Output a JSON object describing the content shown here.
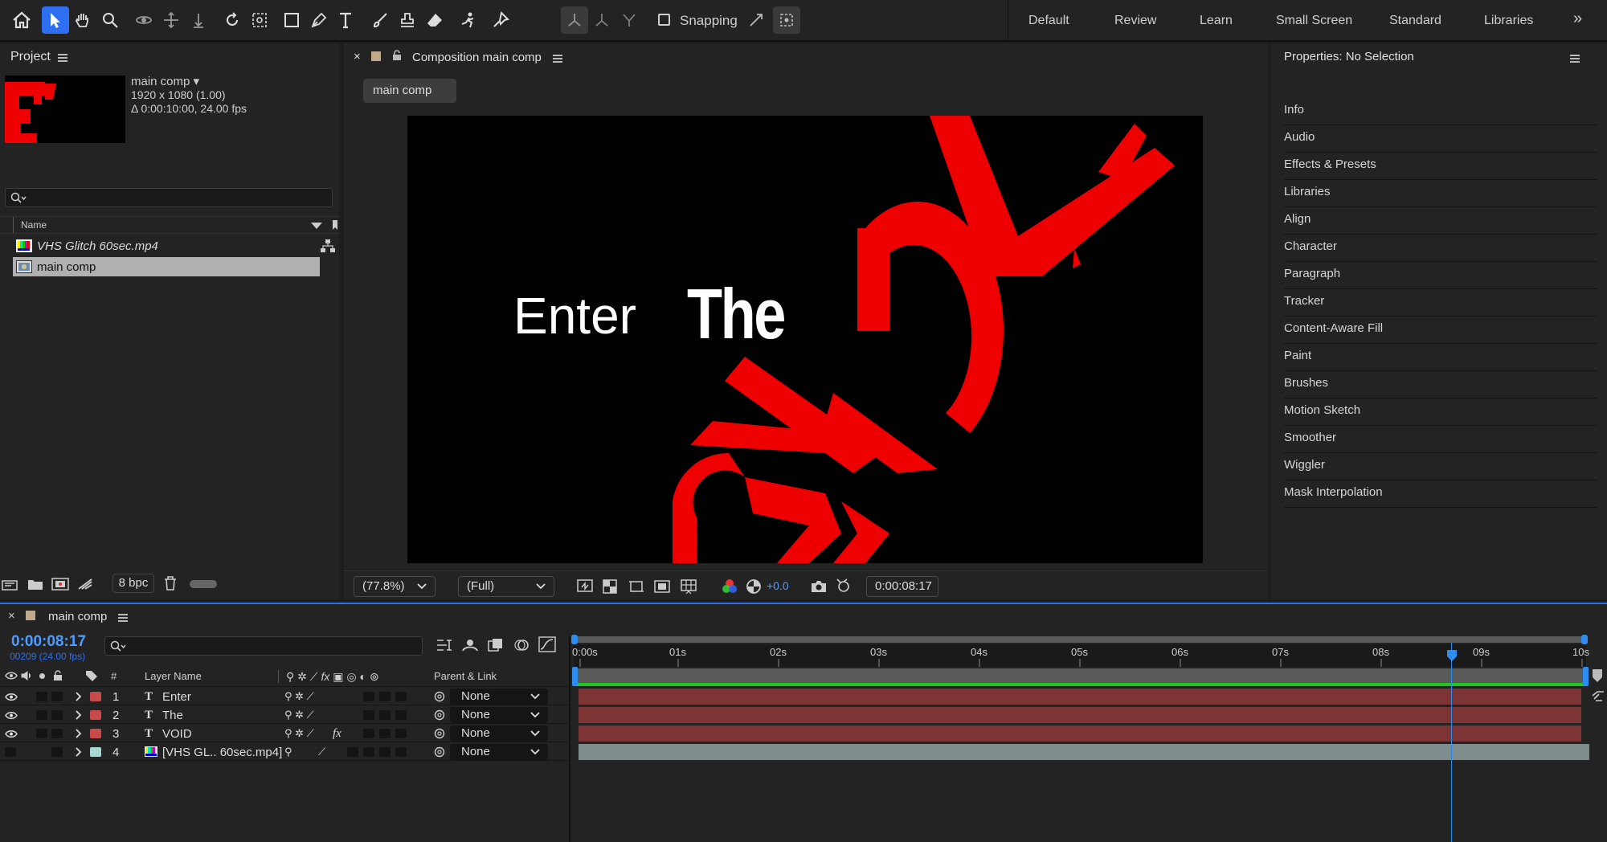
{
  "toolbar": {
    "snapping_label": "Snapping",
    "workspaces": [
      "Default",
      "Review",
      "Learn",
      "Small Screen",
      "Standard",
      "Libraries"
    ],
    "overflow": "»"
  },
  "project": {
    "title": "Project",
    "comp_name": "main comp ▾",
    "comp_size": "1920 x 1080 (1.00)",
    "comp_duration": "Δ 0:00:10:00, 24.00 fps",
    "search_placeholder": "",
    "column_name": "Name",
    "items": [
      {
        "name": "VHS Glitch 60sec.mp4",
        "type": "footage"
      },
      {
        "name": "main comp",
        "type": "composition"
      }
    ],
    "bpc": "8 bpc"
  },
  "viewer": {
    "close": "×",
    "title": "Composition main comp",
    "tab": "main comp",
    "canvas_text_enter": "Enter",
    "canvas_text_the": "The",
    "zoom": "(77.8%)",
    "resolution": "(Full)",
    "exposure": "+0.0",
    "timecode": "0:00:08:17"
  },
  "properties": {
    "title": "Properties: No Selection",
    "items": [
      "Info",
      "Audio",
      "Effects & Presets",
      "Libraries",
      "Align",
      "Character",
      "Paragraph",
      "Tracker",
      "Content-Aware Fill",
      "Paint",
      "Brushes",
      "Motion Sketch",
      "Smoother",
      "Wiggler",
      "Mask Interpolation"
    ]
  },
  "timeline": {
    "close": "×",
    "tab": "main comp",
    "timecode": "0:00:08:17",
    "frame_info": "00209 (24.00 fps)",
    "col_num": "#",
    "col_layer_name": "Layer Name",
    "col_parent": "Parent & Link",
    "ruler": [
      "0:00s",
      "01s",
      "02s",
      "03s",
      "04s",
      "05s",
      "06s",
      "07s",
      "08s",
      "09s",
      "10s"
    ],
    "layers": [
      {
        "num": "1",
        "type_icon": "T",
        "name": "Enter",
        "label_color": "#c84a4a",
        "parent": "None",
        "fx": ""
      },
      {
        "num": "2",
        "type_icon": "T",
        "name": "The",
        "label_color": "#c84a4a",
        "parent": "None",
        "fx": ""
      },
      {
        "num": "3",
        "type_icon": "T",
        "name": "VOID",
        "label_color": "#c84a4a",
        "parent": "None",
        "fx": "fx"
      },
      {
        "num": "4",
        "type_icon": "",
        "name": "[VHS GL.. 60sec.mp4]",
        "label_color": "#a7d6d3",
        "parent": "None",
        "fx": ""
      }
    ],
    "colors": {
      "text_bar": "#7d3434",
      "video_bar": "#7f8c8d",
      "work_area": "#1ec81e",
      "playhead": "#2d8cf0"
    }
  }
}
